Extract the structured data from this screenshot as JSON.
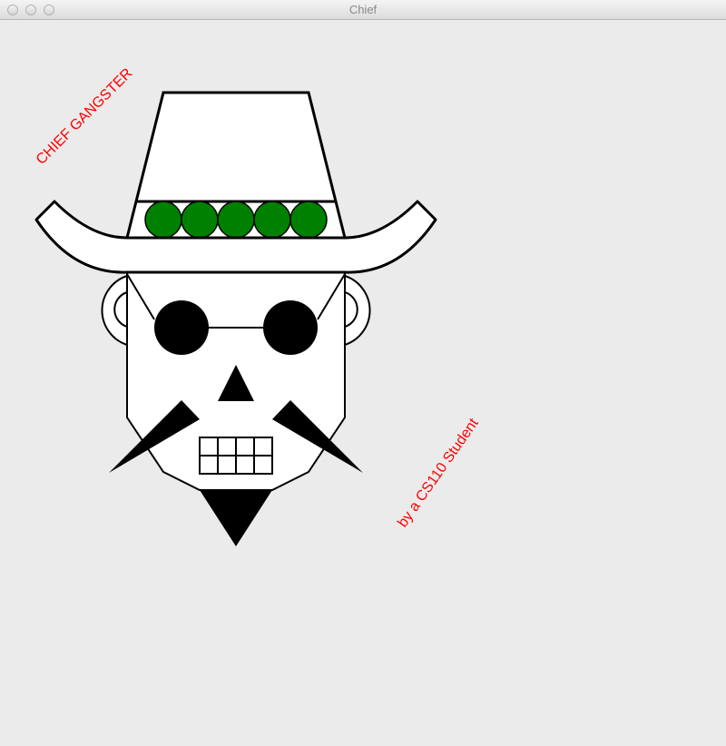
{
  "window": {
    "title": "Chief"
  },
  "canvas": {
    "background": "#ebebeb",
    "texts": {
      "top_label": "CHIEF GANGSTER",
      "bottom_label": "by a CS110 Student",
      "text_color": "#ff0000"
    },
    "colors": {
      "hat_band_circles": "#008000",
      "outline": "#000000",
      "fill": "#ffffff"
    },
    "hat": {
      "band_circle_count": 5
    },
    "teeth": {
      "rows": 2,
      "columns": 4
    }
  }
}
